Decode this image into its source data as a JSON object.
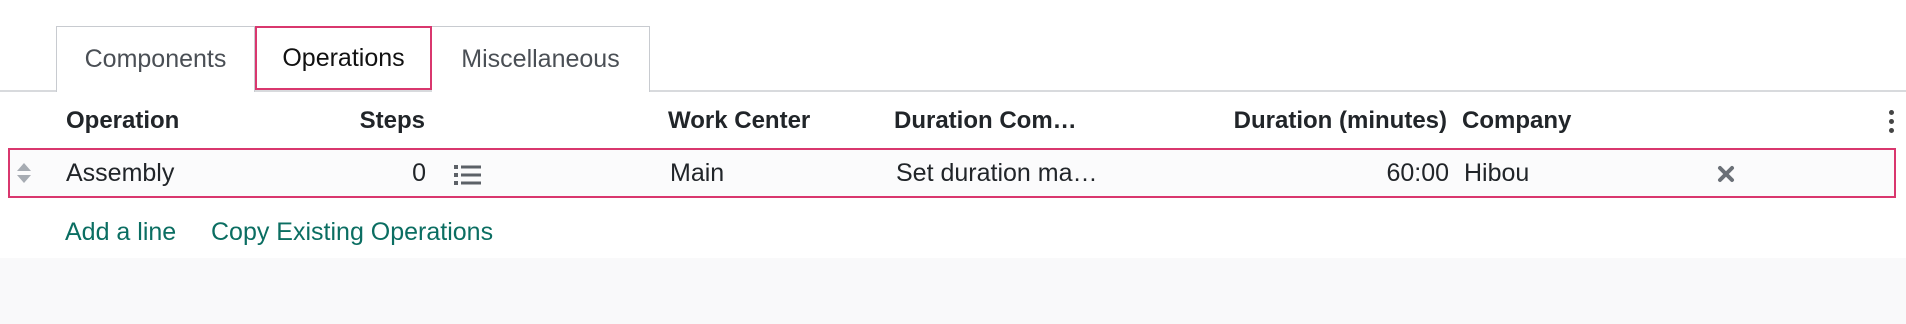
{
  "tabs": [
    {
      "label": "Components"
    },
    {
      "label": "Operations"
    },
    {
      "label": "Miscellaneous"
    }
  ],
  "active_tab": "Operations",
  "table": {
    "columns": [
      "Operation",
      "Steps",
      "Work Center",
      "Duration Com…",
      "Duration (minutes)",
      "Company"
    ],
    "rows": [
      {
        "operation": "Assembly",
        "steps": "0",
        "work_center": "Main",
        "duration_computation": "Set duration ma…",
        "duration_minutes": "60:00",
        "company": "Hibou"
      }
    ]
  },
  "actions": {
    "add_line": "Add a line",
    "copy_operations": "Copy Existing Operations"
  },
  "icons": {
    "row_handle": "drag-handle-icon",
    "steps": "list-icon",
    "remove": "remove-icon",
    "columns_menu": "kebab-menu-icon"
  },
  "colors": {
    "highlight": "#d9376e",
    "link": "#0b6e62"
  }
}
